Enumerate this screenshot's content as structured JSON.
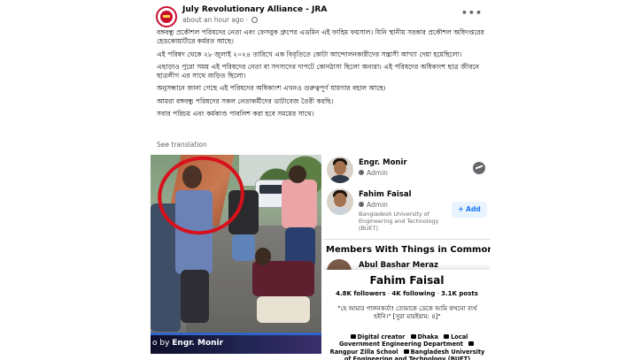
{
  "post": {
    "page_name": "July Revolutionary Alliance - JRA",
    "time": "about an hour ago",
    "separator": "·",
    "more_label": "•••",
    "paragraphs": [
      "বঙ্গবন্ধু প্রকৌশল পরিষদের নেতা এবং ফেসবুক গ্রুপের এডমিন এই ফাহিম ফয়সাল। যিনি স্থানীয় সরকার প্রকৌশল অধিদপ্তরের হেডকোয়ার্টারে কর্মরত আছে।",
      "এই পরিষদ থেকে ২৮ জুলাই ২০২৪ তারিখে এক বিবৃতিতে কোটা আন্দোলনকারীদের সন্ত্রাসী আখ্যা দেয়া হয়েছিলো।",
      "এছাড়াও পুরো সময় এই পরিষদের নেতা বা সদস্যদের দাপটে কোনঠাসা ছিলো অন্যরা। এই পরিষদের অধিকাংশ ছাত্র জীবনে ছাত্রলীগ এর সাথে জড়িত ছিলো।",
      "অনুসন্ধানে জানা গেছে এই পরিষদের অধিকাংশ এখনও গুরুত্বপূর্ণ যায়গার বহাল আছে।",
      "আমরা বঙ্গবন্ধু পরিষদের সকল নেতাকর্মীদের ডাটাবেজ তৈরী করছি।",
      "সবার পরিচয় এবং কর্মকাণ্ড পাবলিশ করা হবে সময়ের সাথে।"
    ],
    "see_translation": "See translation"
  },
  "photo": {
    "caption_prefix": "o by ",
    "caption_name": "Engr. Monir"
  },
  "side": {
    "member1": {
      "name": "Engr. Monir",
      "role": "Admin"
    },
    "member2": {
      "name": "Fahim Faisal",
      "role": "Admin",
      "education": "Bangladesh University of Engineering and Technology (BUET)",
      "add_label": "Add"
    },
    "common_title": "Members With Things in Common",
    "member3": {
      "name": "Abul Bashar Meraz"
    }
  },
  "profile_card": {
    "name": "Fahim Faisal",
    "followers": "4.8K followers",
    "following": "4K following",
    "posts": "3.1K posts",
    "stat_separator": "·",
    "bio": "\"হে আমার পালনকর্তা! তোমাকে ডেকে আমি কখনো ব্যর্থ হইনি।\" [সুরা মারইয়াম: ৪]\"",
    "occupation": "Digital creator",
    "city": "Dhaka",
    "work": "Local Government Engineering Department",
    "school": "Rangpur Zilla School",
    "university": "Bangladesh University of Engineering and Technology (BUET)"
  },
  "colors": {
    "accent": "#1877f2",
    "circle": "#d8101c",
    "caption_bg": "#242657"
  }
}
